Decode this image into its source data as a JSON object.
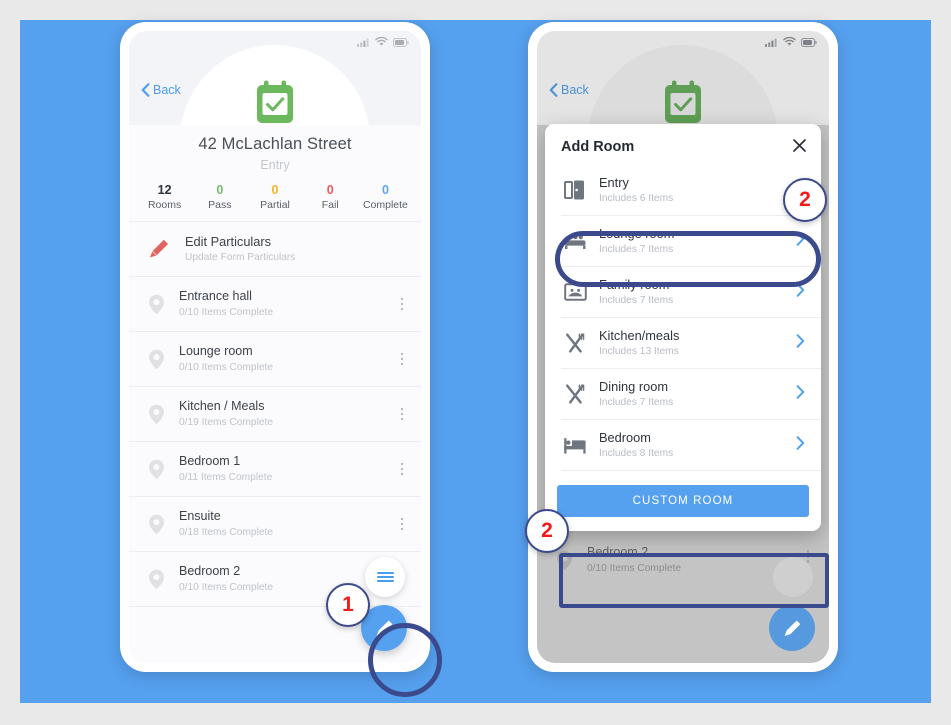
{
  "colors": {
    "canvas_bg": "#55a0ef",
    "page_bg": "#e9e9e9",
    "accent_blue": "#55a0ef",
    "link_blue": "#4a9ced",
    "highlight_navy": "#3b4a8c",
    "badge_red": "#f21b1b",
    "pass_green": "#73bf6a",
    "partial_amber": "#f0b429",
    "fail_red": "#ef5b5b",
    "complete_blue": "#5aa7ee",
    "calendar_green": "#6cb85c",
    "edit_pencil_red": "#e2645e"
  },
  "left_phone": {
    "status_bar": {
      "signal_icon": "signal-bars-icon",
      "wifi_icon": "wifi-icon",
      "battery_icon": "battery-icon"
    },
    "back_label": "Back",
    "back_icon": "chevron-left-icon",
    "header_icon": "calendar-check-icon",
    "address": "42 McLachlan Street",
    "form_type": "Entry",
    "stats": [
      {
        "value": "12",
        "label": "Rooms",
        "color": "#2f353d"
      },
      {
        "value": "0",
        "label": "Pass",
        "color": "#73bf6a"
      },
      {
        "value": "0",
        "label": "Partial",
        "color": "#f0b429"
      },
      {
        "value": "0",
        "label": "Fail",
        "color": "#ef5b5b"
      },
      {
        "value": "0",
        "label": "Complete",
        "color": "#5aa7ee"
      }
    ],
    "edit_particulars": {
      "icon": "pencil-icon",
      "title": "Edit Particulars",
      "subtitle": "Update Form Particulars"
    },
    "rooms": [
      {
        "icon": "map-pin-icon",
        "name": "Entrance hall",
        "progress": "0/10 Items Complete",
        "menu_icon": "kebab-menu-icon"
      },
      {
        "icon": "map-pin-icon",
        "name": "Lounge room",
        "progress": "0/10 Items Complete",
        "menu_icon": "kebab-menu-icon"
      },
      {
        "icon": "map-pin-icon",
        "name": "Kitchen / Meals",
        "progress": "0/19 Items Complete",
        "menu_icon": "kebab-menu-icon"
      },
      {
        "icon": "map-pin-icon",
        "name": "Bedroom 1",
        "progress": "0/11 Items Complete",
        "menu_icon": "kebab-menu-icon"
      },
      {
        "icon": "map-pin-icon",
        "name": "Ensuite",
        "progress": "0/18 Items Complete",
        "menu_icon": "kebab-menu-icon"
      },
      {
        "icon": "map-pin-icon",
        "name": "Bedroom 2",
        "progress": "0/10 Items Complete",
        "menu_icon": "kebab-menu-icon"
      }
    ],
    "fab_menu_icon": "hamburger-menu-icon",
    "fab_edit_icon": "pencil-icon",
    "callout": {
      "number": "1"
    }
  },
  "right_phone": {
    "status_bar": {
      "signal_icon": "signal-bars-icon",
      "wifi_icon": "wifi-icon",
      "battery_icon": "battery-icon"
    },
    "back_label": "Back",
    "back_icon": "chevron-left-icon",
    "header_icon": "calendar-check-icon",
    "background_rooms": [
      {
        "icon": "map-pin-icon",
        "name": "Bedroom 2",
        "progress": "0/10 Items Complete",
        "menu_icon": "kebab-menu-icon"
      }
    ],
    "fab_edit_icon": "pencil-icon",
    "dialog": {
      "title": "Add Room",
      "close_icon": "close-x-icon",
      "options": [
        {
          "icon": "door-icon",
          "name": "Entry",
          "subtitle": "Includes 6 Items",
          "chevron": "chevron-right-icon",
          "has_chevron": false,
          "highlighted": false
        },
        {
          "icon": "sofa-icon",
          "name": "Lounge room",
          "subtitle": "Includes 7 Items",
          "chevron": "chevron-right-icon",
          "has_chevron": true,
          "highlighted": true
        },
        {
          "icon": "tv-icon",
          "name": "Family room",
          "subtitle": "Includes 7 Items",
          "chevron": "chevron-right-icon",
          "has_chevron": true,
          "highlighted": false
        },
        {
          "icon": "cutlery-icon",
          "name": "Kitchen/meals",
          "subtitle": "Includes 13 Items",
          "chevron": "chevron-right-icon",
          "has_chevron": true,
          "highlighted": false
        },
        {
          "icon": "cutlery-icon",
          "name": "Dining room",
          "subtitle": "Includes 7 Items",
          "chevron": "chevron-right-icon",
          "has_chevron": true,
          "highlighted": false
        },
        {
          "icon": "bed-icon",
          "name": "Bedroom",
          "subtitle": "Includes 8 Items",
          "chevron": "chevron-right-icon",
          "has_chevron": true,
          "highlighted": false
        }
      ],
      "custom_room_label": "CUSTOM ROOM"
    },
    "callout_top": {
      "number": "2"
    },
    "callout_bottom": {
      "number": "2"
    }
  }
}
